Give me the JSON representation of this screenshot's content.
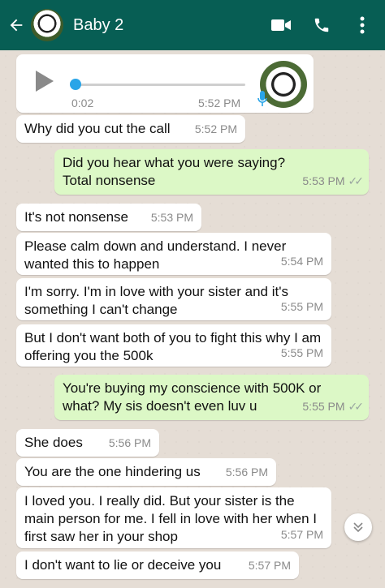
{
  "header": {
    "contact_name": "Baby 2",
    "back_icon": "arrow-left-icon",
    "video_icon": "video-camera-icon",
    "call_icon": "phone-icon",
    "menu_icon": "more-vertical-icon",
    "colors": {
      "bar": "#075e54",
      "incoming": "#ffffff",
      "outgoing": "#dcf8c6",
      "accent": "#2aa5e8"
    }
  },
  "voice_note": {
    "duration": "0:02",
    "time": "5:52 PM",
    "progress": 0.0
  },
  "messages": [
    {
      "dir": "in",
      "text": "Why did you cut the call",
      "time": "5:52 PM"
    },
    {
      "dir": "out",
      "text": "Did you hear what you were saying? Total nonsense",
      "time": "5:53 PM"
    },
    {
      "dir": "in",
      "text": "It's not nonsense",
      "time": "5:53 PM"
    },
    {
      "dir": "in",
      "text": "Please calm down and understand. I never wanted this to happen",
      "time": "5:54 PM"
    },
    {
      "dir": "in",
      "text": "I'm sorry.  I'm in love with your sister and it's something I can't change",
      "time": "5:55 PM"
    },
    {
      "dir": "in",
      "text": "But I don't want both of you to fight this why I am offering you the 500k",
      "time": "5:55 PM"
    },
    {
      "dir": "out",
      "text": "You're buying my conscience with 500K or what? My sis doesn't even luv u",
      "time": "5:55 PM"
    },
    {
      "dir": "in",
      "text": "She does",
      "time": "5:56 PM"
    },
    {
      "dir": "in",
      "text": "You are the one hindering us",
      "time": "5:56 PM"
    },
    {
      "dir": "in",
      "text": "I loved you. I really did.  But your sister is the main person for me.  I fell in love with her when I first saw her in your shop",
      "time": "5:57 PM"
    },
    {
      "dir": "in",
      "text": "I don't want to lie or deceive you",
      "time": "5:57 PM"
    }
  ],
  "scroll_icon": "chevron-double-down-icon"
}
